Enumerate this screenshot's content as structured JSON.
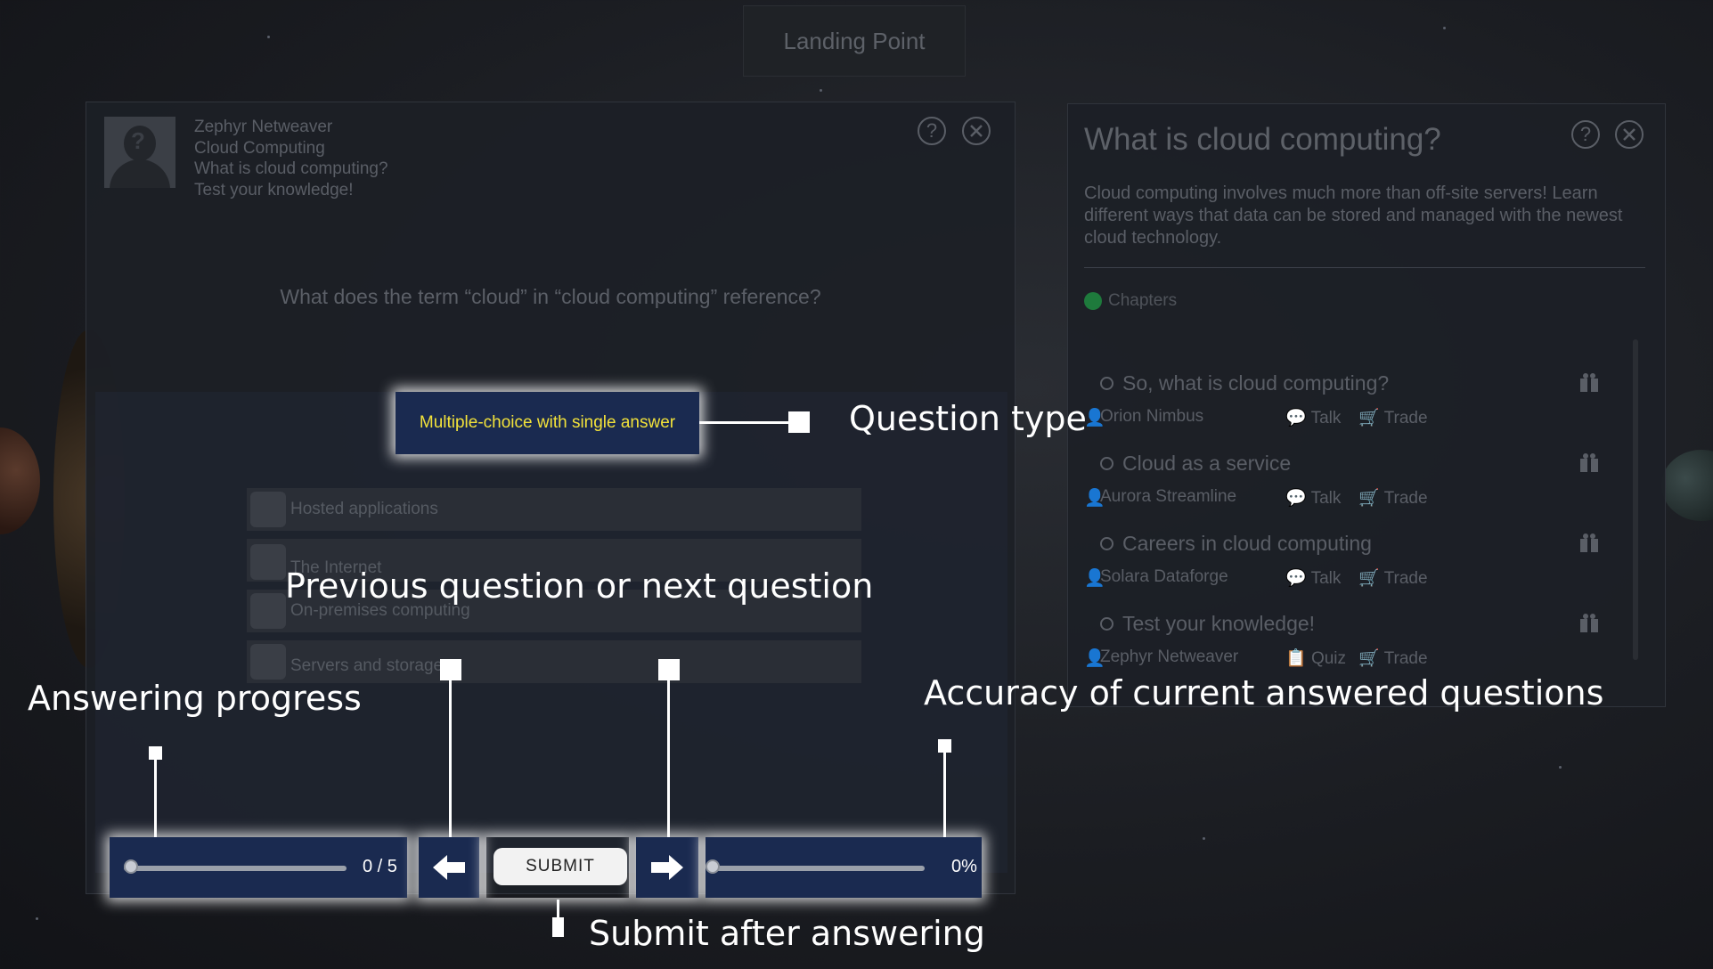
{
  "top_tab": "Landing Point",
  "quiz": {
    "lines": [
      "Zephyr Netweaver",
      "Cloud Computing",
      "What is cloud computing?",
      "Test your knowledge!"
    ],
    "help_icon": "?",
    "question": "What does the term “cloud” in “cloud computing” reference?",
    "question_type": "Multiple-choice with single answer",
    "answers": [
      "Hosted applications",
      "The Internet",
      "On-premises computing",
      "Servers and storage"
    ],
    "progress_text": "0 / 5",
    "progress": 0.0,
    "submit_label": "SUBMIT",
    "accuracy_text": "0%",
    "accuracy": 0.0
  },
  "info": {
    "title": "What is cloud computing?",
    "description": "Cloud computing involves much more than off-site servers! Learn different ways that data can be stored and managed with the newest cloud technology.",
    "chapters_label": "Chapters",
    "chapters": [
      {
        "title": "So, what is cloud computing?",
        "npc": "Orion Nimbus",
        "action1": "Talk",
        "action2": "Trade"
      },
      {
        "title": "Cloud as a service",
        "npc": "Aurora Streamline",
        "action1": "Talk",
        "action2": "Trade"
      },
      {
        "title": "Careers in cloud computing",
        "npc": "Solara Dataforge",
        "action1": "Talk",
        "action2": "Trade"
      },
      {
        "title": "Test your knowledge!",
        "npc": "Zephyr Netweaver",
        "action1": "Quiz",
        "action2": "Trade"
      }
    ]
  },
  "callouts": {
    "question_type": "Question type",
    "prev_next": "Previous question or next question",
    "progress": "Answering progress",
    "accuracy": "Accuracy of current answered questions",
    "submit": "Submit after answering"
  },
  "colors": {
    "panel_bg": "#1c1f26",
    "highlight_bar": "#1a2a50",
    "question_type_text": "#f2e23a",
    "callout_text": "#ffffff"
  }
}
